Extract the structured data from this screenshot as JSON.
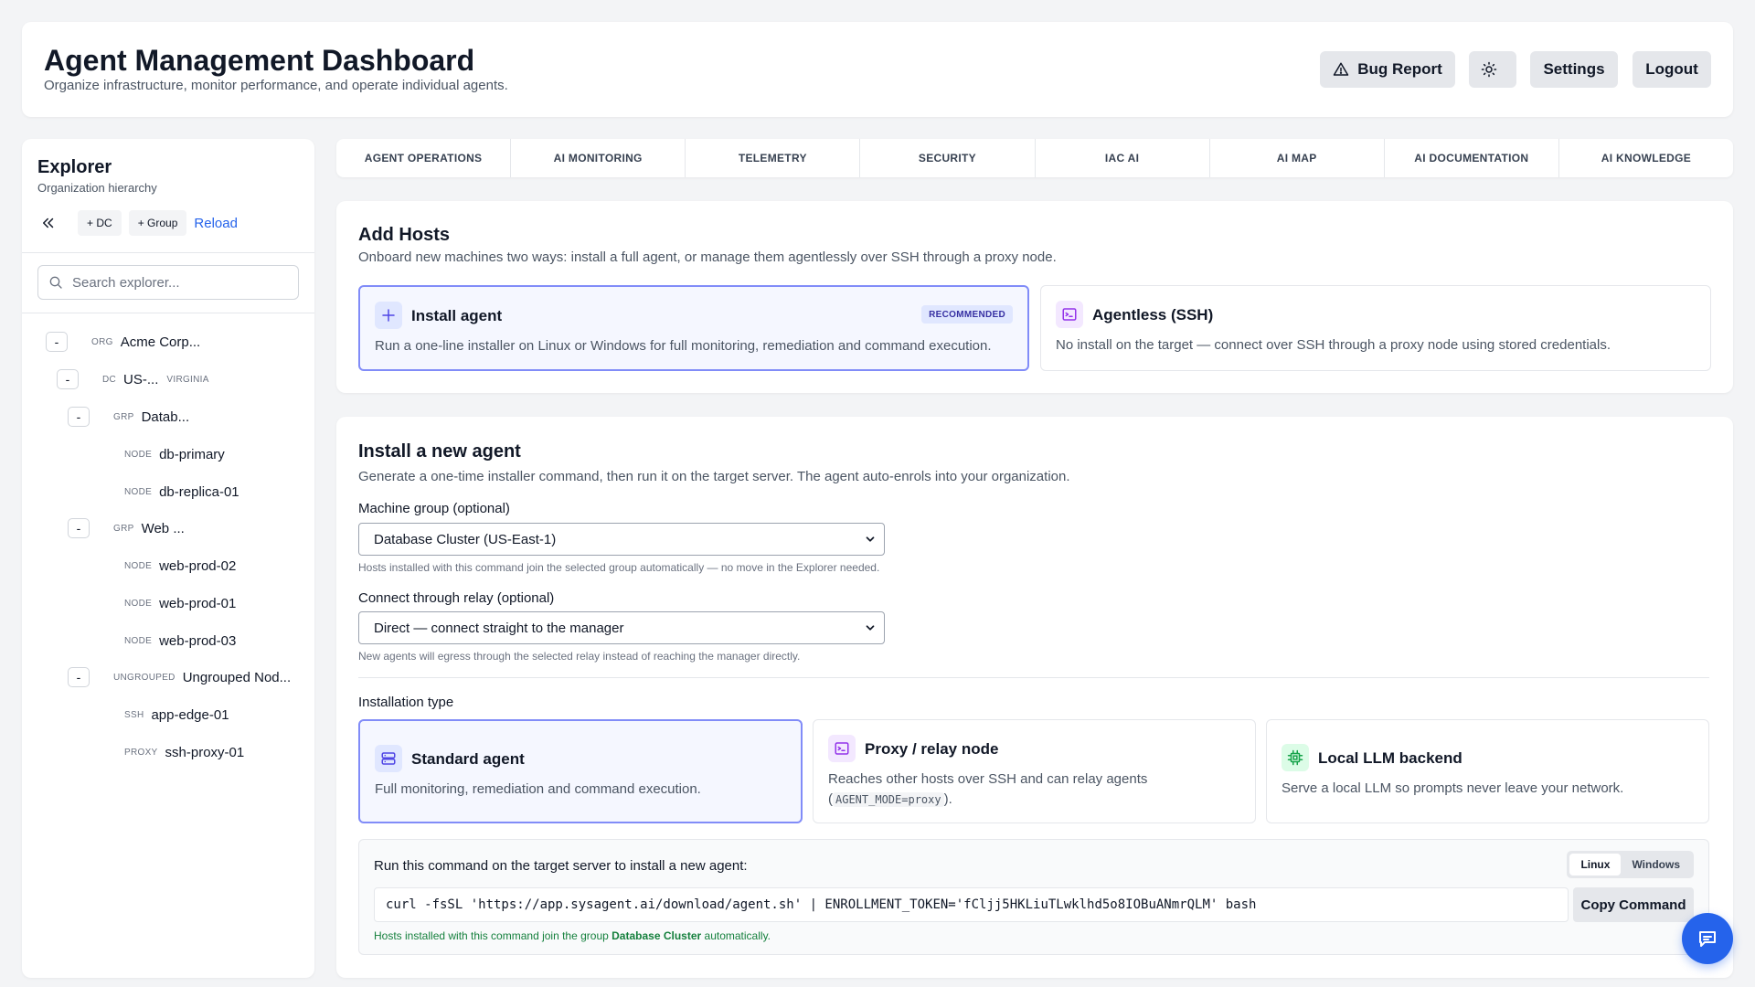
{
  "header": {
    "title": "Agent Management Dashboard",
    "subtitle": "Organize infrastructure, monitor performance, and operate individual agents.",
    "bug_report": "Bug Report",
    "settings": "Settings",
    "logout": "Logout"
  },
  "explorer": {
    "title": "Explorer",
    "subtitle": "Organization hierarchy",
    "add_dc": "+ DC",
    "add_group": "+ Group",
    "reload": "Reload",
    "search_placeholder": "Search explorer...",
    "tree": [
      {
        "toggle": "-",
        "type": "ORG",
        "name": "Acme Corp...",
        "suffix": ""
      },
      {
        "toggle": "-",
        "type": "DC",
        "name": "US-...",
        "suffix": "VIRGINIA"
      },
      {
        "toggle": "-",
        "type": "GRP",
        "name": "Datab...",
        "suffix": ""
      },
      {
        "toggle": "",
        "type": "NODE",
        "name": "db-primary",
        "suffix": ""
      },
      {
        "toggle": "",
        "type": "NODE",
        "name": "db-replica-01",
        "suffix": ""
      },
      {
        "toggle": "-",
        "type": "GRP",
        "name": "Web ...",
        "suffix": ""
      },
      {
        "toggle": "",
        "type": "NODE",
        "name": "web-prod-02",
        "suffix": ""
      },
      {
        "toggle": "",
        "type": "NODE",
        "name": "web-prod-01",
        "suffix": ""
      },
      {
        "toggle": "",
        "type": "NODE",
        "name": "web-prod-03",
        "suffix": ""
      },
      {
        "toggle": "-",
        "type": "UNGROUPED",
        "name": "Ungrouped Nod...",
        "suffix": ""
      },
      {
        "toggle": "",
        "type": "SSH",
        "name": "app-edge-01",
        "suffix": ""
      },
      {
        "toggle": "",
        "type": "PROXY",
        "name": "ssh-proxy-01",
        "suffix": ""
      }
    ]
  },
  "tabs": [
    "AGENT OPERATIONS",
    "AI MONITORING",
    "TELEMETRY",
    "SECURITY",
    "IAC AI",
    "AI MAP",
    "AI DOCUMENTATION",
    "AI KNOWLEDGE"
  ],
  "add_hosts": {
    "title": "Add Hosts",
    "description": "Onboard new machines two ways: install a full agent, or manage them agentlessly over SSH through a proxy node.",
    "install": {
      "title": "Install agent",
      "badge": "RECOMMENDED",
      "description": "Run a one-line installer on Linux or Windows for full monitoring, remediation and command execution."
    },
    "agentless": {
      "title": "Agentless (SSH)",
      "description": "No install on the target — connect over SSH through a proxy node using stored credentials."
    }
  },
  "install_agent": {
    "title": "Install a new agent",
    "description": "Generate a one-time installer command, then run it on the target server. The agent auto-enrols into your organization.",
    "group_label": "Machine group (optional)",
    "group_value": "Database Cluster (US-East-1)",
    "group_help": "Hosts installed with this command join the selected group automatically — no move in the Explorer needed.",
    "relay_label": "Connect through relay (optional)",
    "relay_value": "Direct — connect straight to the manager",
    "relay_help": "New agents will egress through the selected relay instead of reaching the manager directly.",
    "type_label": "Installation type",
    "types": {
      "standard": {
        "title": "Standard agent",
        "description": "Full monitoring, remediation and command execution."
      },
      "proxy": {
        "title": "Proxy / relay node",
        "description": "Reaches other hosts over SSH and can relay agents",
        "code": "AGENT_MODE=proxy",
        "paren_open": "(",
        "paren_close": ")."
      },
      "llm": {
        "title": "Local LLM backend",
        "description": "Serve a local LLM so prompts never leave your network."
      }
    },
    "command_label": "Run this command on the target server to install a new agent:",
    "os_linux": "Linux",
    "os_windows": "Windows",
    "selected_os": "Linux",
    "command": "curl -fsSL 'https://app.sysagent.ai/download/agent.sh' | ENROLLMENT_TOKEN='fCljj5HKLiuTLwklhd5o8IOBuANmrQLM' bash",
    "copy": "Copy Command",
    "note_prefix": "Hosts installed with this command join the group",
    "note_group": "Database Cluster",
    "note_suffix": "automatically."
  },
  "colors": {
    "accent": "#2563eb",
    "selected_border": "#818cf8",
    "success_text": "#15803d"
  }
}
